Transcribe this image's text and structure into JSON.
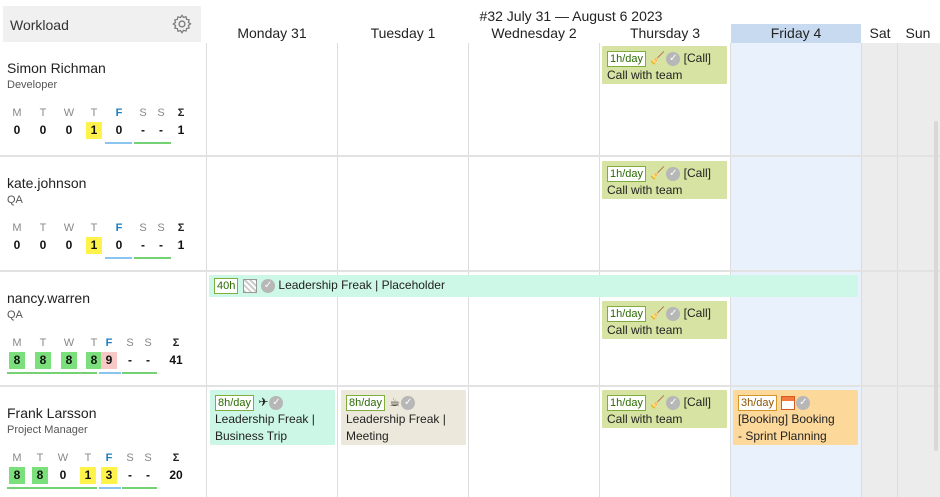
{
  "header": {
    "workload_title": "Workload",
    "week_title": "#32 July 31 — August 6 2023",
    "days": [
      "Monday 31",
      "Tuesday 1",
      "Wednesday 2",
      "Thursday 3",
      "Friday 4",
      "Sat",
      "Sun"
    ],
    "gear_icon": "gear-icon"
  },
  "week_letters": [
    "M",
    "T",
    "W",
    "T",
    "F",
    "S",
    "S",
    "Σ"
  ],
  "users": [
    {
      "name": "Simon Richman",
      "role": "Developer",
      "values": [
        "0",
        "0",
        "0",
        "1",
        "0",
        "-",
        "-",
        "1"
      ]
    },
    {
      "name": "kate.johnson",
      "role": "QA",
      "values": [
        "0",
        "0",
        "0",
        "1",
        "0",
        "-",
        "-",
        "1"
      ]
    },
    {
      "name": "nancy.warren",
      "role": "QA",
      "values": [
        "8",
        "8",
        "8",
        "8",
        "9",
        "-",
        "-",
        "41"
      ]
    },
    {
      "name": "Frank Larsson",
      "role": "Project Manager",
      "values": [
        "8",
        "8",
        "0",
        "1",
        "3",
        "-",
        "-",
        "20"
      ]
    }
  ],
  "events": {
    "call": {
      "tag": "1h/day",
      "type": "[Call]",
      "title": "Call with team"
    },
    "leadership": {
      "tag": "40h",
      "title": "Leadership Freak | Placeholder"
    },
    "trip": {
      "tag": "8h/day",
      "title1": "Leadership Freak |",
      "title2": "Business Trip"
    },
    "meeting": {
      "tag": "8h/day",
      "title1": "Leadership Freak |",
      "title2": "Meeting"
    },
    "booking": {
      "tag": "3h/day",
      "title1": "[Booking] Booking",
      "title2": "- Sprint Planning"
    }
  }
}
